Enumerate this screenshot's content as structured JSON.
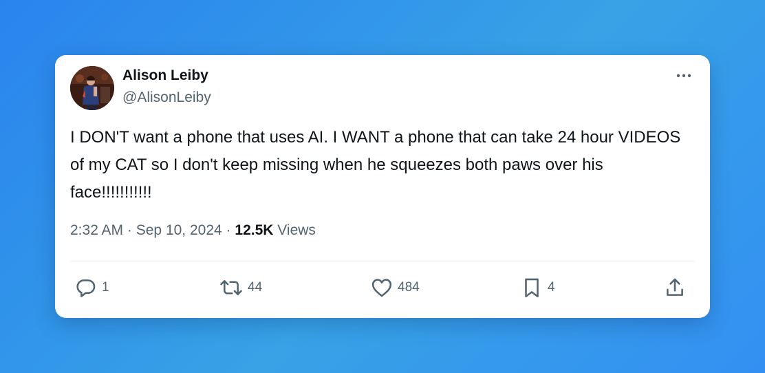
{
  "author": {
    "display_name": "Alison Leiby",
    "handle": "@AlisonLeiby"
  },
  "tweet": {
    "text": "I DON'T want a phone that uses AI. I WANT a phone that can take 24 hour VIDEOS of my CAT so I don't keep missing when he squeezes both paws over his face!!!!!!!!!!!"
  },
  "meta": {
    "time": "2:32 AM",
    "separator": "·",
    "date": "Sep 10, 2024",
    "views_count": "12.5K",
    "views_label": "Views"
  },
  "actions": {
    "replies": "1",
    "reposts": "44",
    "likes": "484",
    "bookmarks": "4"
  },
  "icons": {
    "more": "more-horizontal-icon",
    "reply": "reply-icon",
    "repost": "repost-icon",
    "like": "heart-icon",
    "bookmark": "bookmark-icon",
    "share": "share-icon"
  },
  "colors": {
    "background_start": "#2a84ee",
    "background_end": "#3390f2",
    "card": "#ffffff",
    "primary_text": "#0f1419",
    "secondary_text": "#536471"
  }
}
